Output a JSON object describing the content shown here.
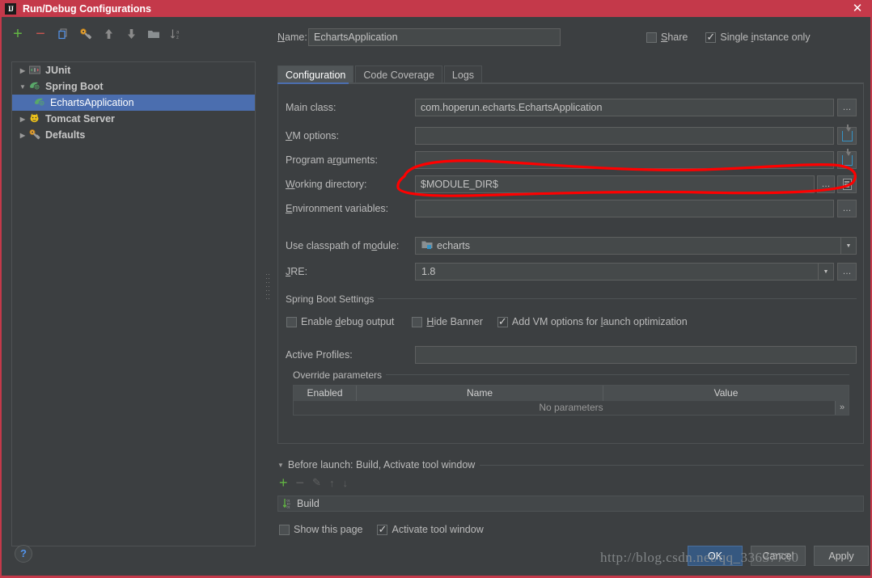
{
  "window": {
    "title": "Run/Debug Configurations",
    "logo_text": "IJ",
    "close_label": "✕"
  },
  "toolbar": {
    "items": [
      {
        "name": "add-button",
        "glyph": "+",
        "title": "Add New Configuration"
      },
      {
        "name": "remove-button",
        "glyph": "−",
        "title": "Remove Configuration"
      },
      {
        "name": "copy-button",
        "glyph": "",
        "title": "Copy Configuration"
      },
      {
        "name": "edit-defaults-button",
        "glyph": "",
        "title": "Edit defaults"
      },
      {
        "name": "move-up-button",
        "glyph": "↑",
        "title": "Move Up"
      },
      {
        "name": "move-down-button",
        "glyph": "↓",
        "title": "Move Down"
      },
      {
        "name": "folder-button",
        "glyph": "",
        "title": "Create New Folder"
      },
      {
        "name": "sort-button",
        "glyph": "",
        "title": "Sort Configurations"
      }
    ]
  },
  "tree": {
    "items": [
      {
        "label": "JUnit",
        "expanded": false,
        "selected": false,
        "indent": 0,
        "icon": "junit-icon"
      },
      {
        "label": "Spring Boot",
        "expanded": true,
        "selected": false,
        "indent": 0,
        "icon": "spring-boot-icon"
      },
      {
        "label": "EchartsApplication",
        "expanded": null,
        "selected": true,
        "indent": 1,
        "icon": "spring-boot-icon"
      },
      {
        "label": "Tomcat Server",
        "expanded": false,
        "selected": false,
        "indent": 0,
        "icon": "tomcat-icon"
      },
      {
        "label": "Defaults",
        "expanded": false,
        "selected": false,
        "indent": 0,
        "icon": "wrench-icon"
      }
    ]
  },
  "help": {
    "label": "?"
  },
  "form": {
    "name_label": "Name:",
    "name_value": "EchartsApplication",
    "share_label": "Share",
    "share_checked": false,
    "single_instance_label": "Single instance only",
    "single_instance_checked": true
  },
  "tabs": [
    {
      "label": "Configuration",
      "active": true
    },
    {
      "label": "Code Coverage",
      "active": false
    },
    {
      "label": "Logs",
      "active": false
    }
  ],
  "configuration": {
    "main_class_label": "Main class:",
    "main_class_value": "com.hoperun.echarts.EchartsApplication",
    "vm_options_label": "VM options:",
    "vm_options_value": "",
    "program_arguments_label": "Program arguments:",
    "program_arguments_value": "",
    "working_directory_label": "Working directory:",
    "working_directory_value": "$MODULE_DIR$",
    "environment_variables_label": "Environment variables:",
    "environment_variables_value": "",
    "use_classpath_label": "Use classpath of module:",
    "use_classpath_value": "echarts",
    "jre_label": "JRE:",
    "jre_value": "1.8",
    "browse_label": "…"
  },
  "spring_boot_settings": {
    "group_label": "Spring Boot Settings",
    "enable_debug_output_label": "Enable debug output",
    "enable_debug_output_checked": false,
    "hide_banner_label": "Hide Banner",
    "hide_banner_checked": false,
    "add_vm_options_label": "Add VM options for launch optimization",
    "add_vm_options_checked": true,
    "active_profiles_label": "Active Profiles:",
    "active_profiles_value": "",
    "override_parameters": {
      "group_label": "Override parameters",
      "columns": [
        "Enabled",
        "Name",
        "Value"
      ],
      "empty_text": "No parameters",
      "more_glyph": "»"
    }
  },
  "before_launch": {
    "header": "Before launch: Build, Activate tool window",
    "toolbar": [
      {
        "name": "bl-add-button",
        "glyph": "+"
      },
      {
        "name": "bl-remove-button",
        "glyph": "−"
      },
      {
        "name": "bl-edit-button",
        "glyph": "✎"
      },
      {
        "name": "bl-move-up-button",
        "glyph": "↑"
      },
      {
        "name": "bl-move-down-button",
        "glyph": "↓"
      }
    ],
    "tasks": [
      {
        "label": "Build",
        "icon": "build-icon"
      }
    ],
    "show_this_page_label": "Show this page",
    "show_this_page_checked": false,
    "activate_tool_window_label": "Activate tool window",
    "activate_tool_window_checked": true
  },
  "footer": {
    "ok_label": "OK",
    "cancel_label": "Cancel",
    "apply_label": "Apply"
  },
  "watermark": "http://blog.csdn.net/qq_33637750",
  "colors": {
    "title_bar": "#c4394a",
    "background": "#3c3f41",
    "field_background": "#45494a",
    "selection": "#4b6eaf",
    "accent_green": "#62b543",
    "accent_red": "#c75450",
    "accent_blue": "#3592c4",
    "primary_button": "#365880",
    "annotation_red": "#ff0000"
  }
}
